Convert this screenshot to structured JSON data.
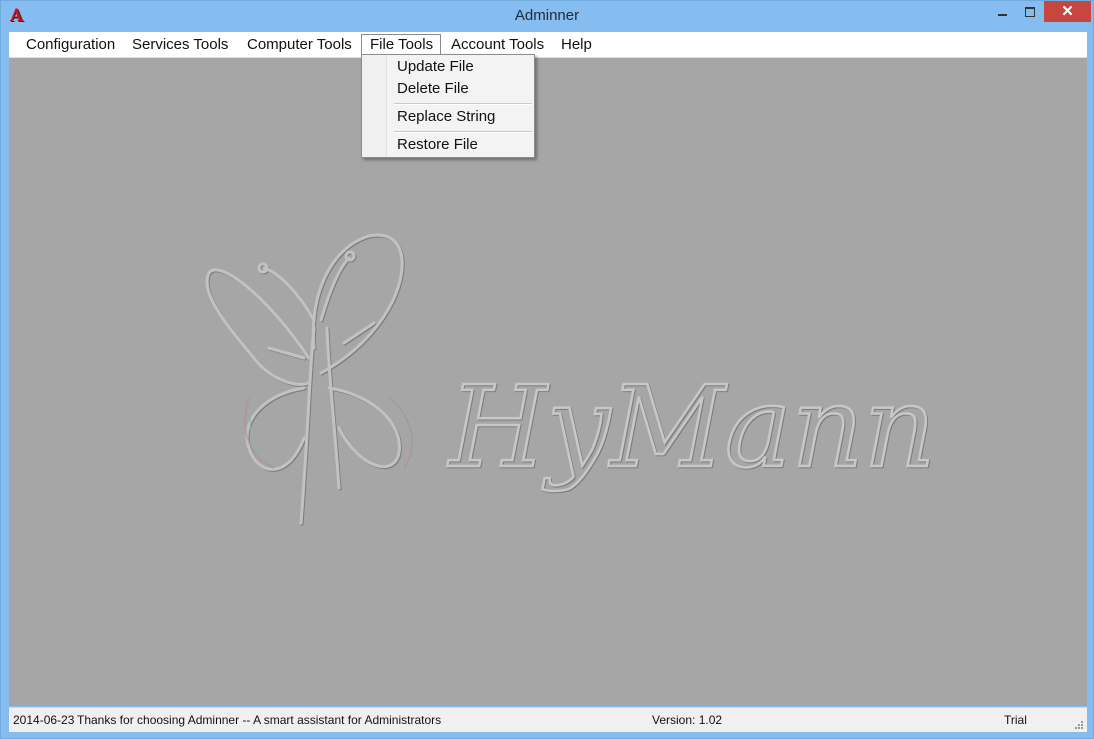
{
  "window": {
    "title": "Adminner",
    "app_icon": "A",
    "controls": {
      "minimize": "minimize-icon",
      "maximize": "maximize-icon",
      "close": "close-icon",
      "close_glyph": "✕"
    }
  },
  "menubar": {
    "items": [
      "Configuration",
      "Services Tools",
      "Computer Tools",
      "File Tools",
      "Account Tools",
      "Help"
    ],
    "active": "File Tools"
  },
  "dropdown": {
    "items": [
      "Update File",
      "Delete File",
      "Replace String",
      "Restore File"
    ]
  },
  "watermark": {
    "text": "HyMann"
  },
  "statusbar": {
    "date": "2014-06-23",
    "message": "Thanks for choosing Adminner -- A smart assistant for Administrators",
    "version": "Version: 1.02",
    "license": "Trial"
  },
  "colors": {
    "titlebar": "#85bdf0",
    "close_button": "#c7463f",
    "client_background": "#a6a6a6"
  }
}
